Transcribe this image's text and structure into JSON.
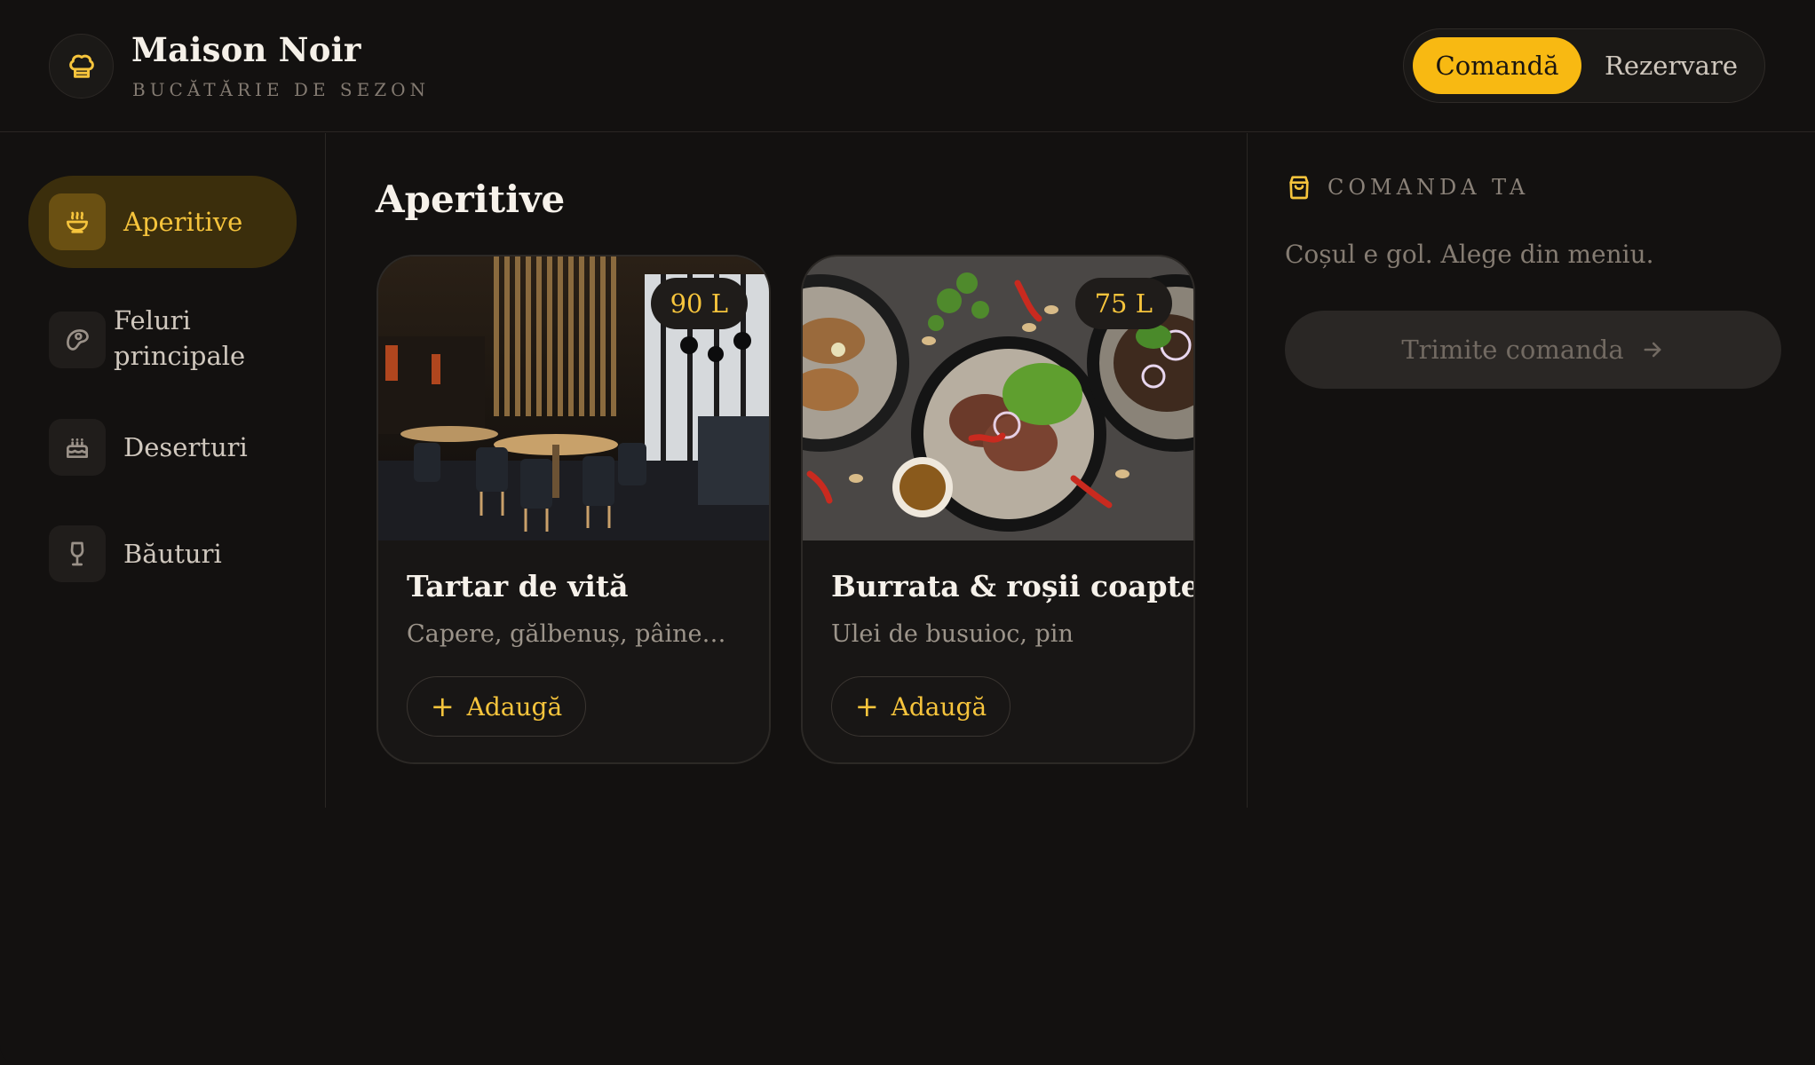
{
  "brand": {
    "title": "Maison Noir",
    "subtitle": "BUCĂTĂRIE DE SEZON",
    "logo_icon": "chef-hat-icon"
  },
  "mode_switch": {
    "options": [
      "Comandă",
      "Rezervare"
    ],
    "selected": "Comandă"
  },
  "sidebar": {
    "categories": [
      {
        "label": "Aperitive",
        "icon": "soup-bowl-icon",
        "active": true
      },
      {
        "label": "Feluri principale",
        "icon": "steak-icon",
        "active": false
      },
      {
        "label": "Deserturi",
        "icon": "cake-icon",
        "active": false
      },
      {
        "label": "Băuturi",
        "icon": "wine-glass-icon",
        "active": false
      }
    ]
  },
  "main": {
    "title": "Aperitive",
    "items": [
      {
        "name": "Tartar de vită",
        "description": "Capere, gălbenuș, pâine…",
        "price": "90 L",
        "add_label": "Adaugă",
        "image": "restaurant interior photo"
      },
      {
        "name": "Burrata & roșii coapte",
        "description": "Ulei de busuioc, pin",
        "price": "75 L",
        "add_label": "Adaugă",
        "image": "plated dishes photo"
      }
    ]
  },
  "order": {
    "title": "COMANDA TA",
    "icon": "shopping-bag-icon",
    "empty_text": "Coșul e gol. Alege din meniu.",
    "submit_label": "Trimite comanda",
    "submit_enabled": false
  },
  "colors": {
    "background": "#131110",
    "accent": "#f8b912",
    "accent_text": "#f6c43c",
    "panel": "#181615"
  }
}
